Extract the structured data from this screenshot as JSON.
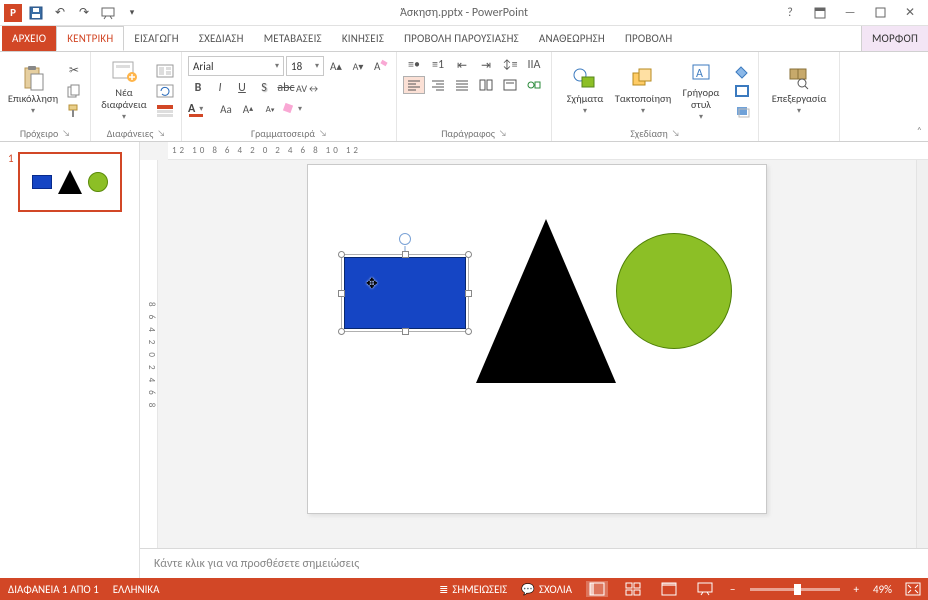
{
  "title": "Άσκηση.pptx - PowerPoint",
  "qat": {
    "app_letter": "P"
  },
  "tabs": {
    "file": "ΑΡΧΕΙΟ",
    "home": "ΚΕΝΤΡΙΚΗ",
    "insert": "ΕΙΣΑΓΩΓΗ",
    "design": "ΣΧΕΔΙΑΣΗ",
    "transitions": "ΜΕΤΑΒΑΣΕΙΣ",
    "animations": "ΚΙΝΗΣΕΙΣ",
    "slideshow": "ΠΡΟΒΟΛΗ ΠΑΡΟΥΣΙΑΣΗΣ",
    "review": "ΑΝΑΘΕΩΡΗΣΗ",
    "view": "ΠΡΟΒΟΛΗ",
    "format": "ΜΟΡΦΟΠ"
  },
  "ribbon": {
    "clipboard": {
      "paste": "Επικόλληση",
      "label": "Πρόχειρο"
    },
    "slides": {
      "new_slide": "Νέα διαφάνεια",
      "label": "Διαφάνειες"
    },
    "font": {
      "name": "Arial",
      "size": "18",
      "label": "Γραμματοσειρά",
      "case_label": "Aa"
    },
    "paragraph": {
      "label": "Παράγραφος"
    },
    "drawing": {
      "shapes": "Σχήματα",
      "arrange": "Τακτοποίηση",
      "quick": "Γρήγορα στυλ",
      "label": "Σχεδίαση"
    },
    "editing": {
      "label": "Επεξεργασία"
    }
  },
  "ruler_h": "12 10 8 6 4 2 0 2 4 6 8 10 12",
  "ruler_v": "8 6 4 2 0 2 4 6 8",
  "thumb": {
    "num": "1"
  },
  "notes_placeholder": "Κάντε κλικ για να προσθέσετε σημειώσεις",
  "status": {
    "slide": "ΔΙΑΦΑΝΕΙΑ 1 ΑΠΟ 1",
    "lang": "ΕΛΛΗΝΙΚΑ",
    "notes": "ΣΗΜΕΙΩΣΕΙΣ",
    "comments": "ΣΧΟΛΙΑ",
    "zoom": "49%"
  },
  "colors": {
    "accent": "#d24726",
    "rect": "#1545c4",
    "circle": "#8cbf26"
  }
}
